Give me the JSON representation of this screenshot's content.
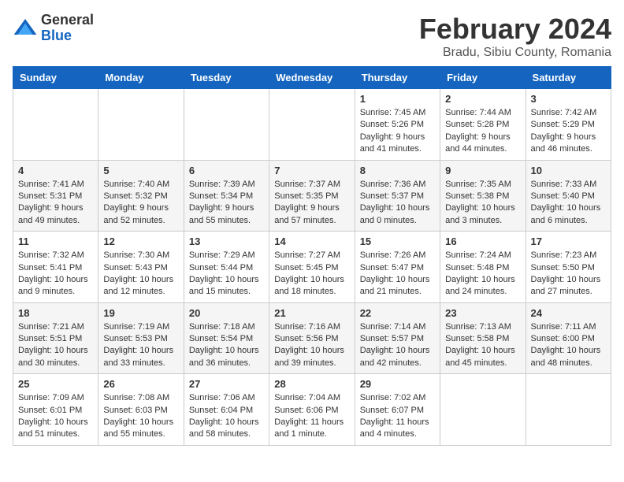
{
  "header": {
    "logo_general": "General",
    "logo_blue": "Blue",
    "title": "February 2024",
    "location": "Bradu, Sibiu County, Romania"
  },
  "days_of_week": [
    "Sunday",
    "Monday",
    "Tuesday",
    "Wednesday",
    "Thursday",
    "Friday",
    "Saturday"
  ],
  "weeks": [
    [
      {
        "day": "",
        "info": ""
      },
      {
        "day": "",
        "info": ""
      },
      {
        "day": "",
        "info": ""
      },
      {
        "day": "",
        "info": ""
      },
      {
        "day": "1",
        "info": "Sunrise: 7:45 AM\nSunset: 5:26 PM\nDaylight: 9 hours\nand 41 minutes."
      },
      {
        "day": "2",
        "info": "Sunrise: 7:44 AM\nSunset: 5:28 PM\nDaylight: 9 hours\nand 44 minutes."
      },
      {
        "day": "3",
        "info": "Sunrise: 7:42 AM\nSunset: 5:29 PM\nDaylight: 9 hours\nand 46 minutes."
      }
    ],
    [
      {
        "day": "4",
        "info": "Sunrise: 7:41 AM\nSunset: 5:31 PM\nDaylight: 9 hours\nand 49 minutes."
      },
      {
        "day": "5",
        "info": "Sunrise: 7:40 AM\nSunset: 5:32 PM\nDaylight: 9 hours\nand 52 minutes."
      },
      {
        "day": "6",
        "info": "Sunrise: 7:39 AM\nSunset: 5:34 PM\nDaylight: 9 hours\nand 55 minutes."
      },
      {
        "day": "7",
        "info": "Sunrise: 7:37 AM\nSunset: 5:35 PM\nDaylight: 9 hours\nand 57 minutes."
      },
      {
        "day": "8",
        "info": "Sunrise: 7:36 AM\nSunset: 5:37 PM\nDaylight: 10 hours\nand 0 minutes."
      },
      {
        "day": "9",
        "info": "Sunrise: 7:35 AM\nSunset: 5:38 PM\nDaylight: 10 hours\nand 3 minutes."
      },
      {
        "day": "10",
        "info": "Sunrise: 7:33 AM\nSunset: 5:40 PM\nDaylight: 10 hours\nand 6 minutes."
      }
    ],
    [
      {
        "day": "11",
        "info": "Sunrise: 7:32 AM\nSunset: 5:41 PM\nDaylight: 10 hours\nand 9 minutes."
      },
      {
        "day": "12",
        "info": "Sunrise: 7:30 AM\nSunset: 5:43 PM\nDaylight: 10 hours\nand 12 minutes."
      },
      {
        "day": "13",
        "info": "Sunrise: 7:29 AM\nSunset: 5:44 PM\nDaylight: 10 hours\nand 15 minutes."
      },
      {
        "day": "14",
        "info": "Sunrise: 7:27 AM\nSunset: 5:45 PM\nDaylight: 10 hours\nand 18 minutes."
      },
      {
        "day": "15",
        "info": "Sunrise: 7:26 AM\nSunset: 5:47 PM\nDaylight: 10 hours\nand 21 minutes."
      },
      {
        "day": "16",
        "info": "Sunrise: 7:24 AM\nSunset: 5:48 PM\nDaylight: 10 hours\nand 24 minutes."
      },
      {
        "day": "17",
        "info": "Sunrise: 7:23 AM\nSunset: 5:50 PM\nDaylight: 10 hours\nand 27 minutes."
      }
    ],
    [
      {
        "day": "18",
        "info": "Sunrise: 7:21 AM\nSunset: 5:51 PM\nDaylight: 10 hours\nand 30 minutes."
      },
      {
        "day": "19",
        "info": "Sunrise: 7:19 AM\nSunset: 5:53 PM\nDaylight: 10 hours\nand 33 minutes."
      },
      {
        "day": "20",
        "info": "Sunrise: 7:18 AM\nSunset: 5:54 PM\nDaylight: 10 hours\nand 36 minutes."
      },
      {
        "day": "21",
        "info": "Sunrise: 7:16 AM\nSunset: 5:56 PM\nDaylight: 10 hours\nand 39 minutes."
      },
      {
        "day": "22",
        "info": "Sunrise: 7:14 AM\nSunset: 5:57 PM\nDaylight: 10 hours\nand 42 minutes."
      },
      {
        "day": "23",
        "info": "Sunrise: 7:13 AM\nSunset: 5:58 PM\nDaylight: 10 hours\nand 45 minutes."
      },
      {
        "day": "24",
        "info": "Sunrise: 7:11 AM\nSunset: 6:00 PM\nDaylight: 10 hours\nand 48 minutes."
      }
    ],
    [
      {
        "day": "25",
        "info": "Sunrise: 7:09 AM\nSunset: 6:01 PM\nDaylight: 10 hours\nand 51 minutes."
      },
      {
        "day": "26",
        "info": "Sunrise: 7:08 AM\nSunset: 6:03 PM\nDaylight: 10 hours\nand 55 minutes."
      },
      {
        "day": "27",
        "info": "Sunrise: 7:06 AM\nSunset: 6:04 PM\nDaylight: 10 hours\nand 58 minutes."
      },
      {
        "day": "28",
        "info": "Sunrise: 7:04 AM\nSunset: 6:06 PM\nDaylight: 11 hours\nand 1 minute."
      },
      {
        "day": "29",
        "info": "Sunrise: 7:02 AM\nSunset: 6:07 PM\nDaylight: 11 hours\nand 4 minutes."
      },
      {
        "day": "",
        "info": ""
      },
      {
        "day": "",
        "info": ""
      }
    ]
  ]
}
